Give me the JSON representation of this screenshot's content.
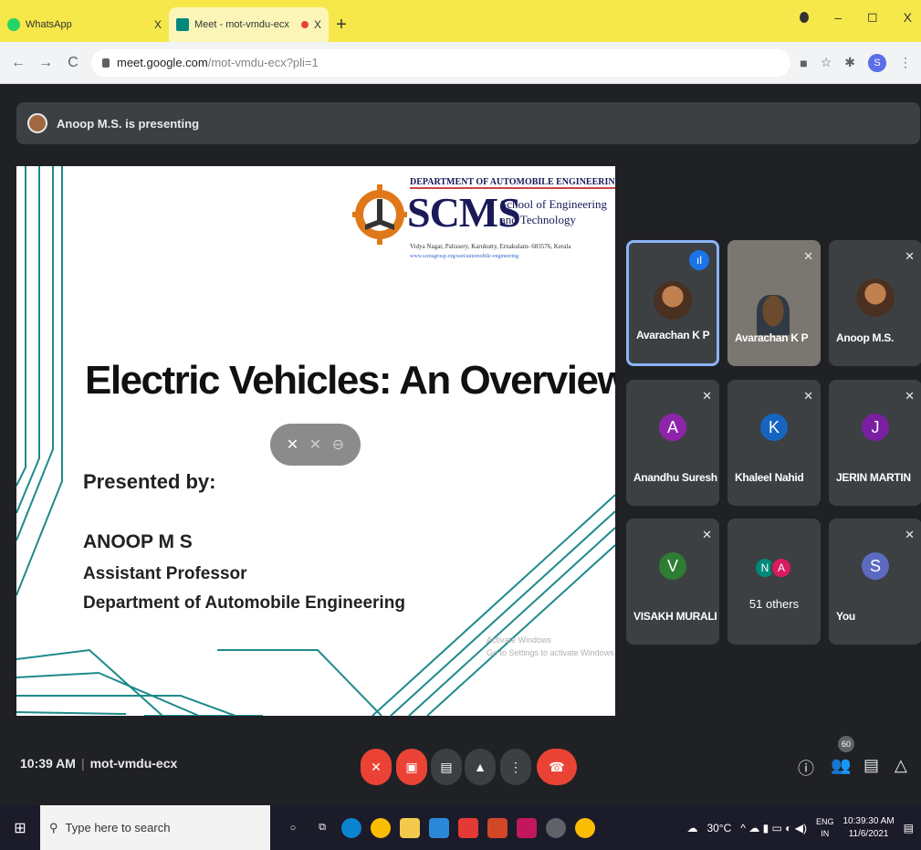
{
  "browser": {
    "tabs": [
      {
        "label": "WhatsApp",
        "close": "X"
      },
      {
        "label": "Meet - mot-vmdu-ecx",
        "close": "X"
      }
    ],
    "new_tab": "+",
    "window_controls": [
      "–",
      "◻",
      "X"
    ],
    "url_host": "meet.google.com",
    "url_path": "/mot-vmdu-ecx?pli=1",
    "profile_initial": "S"
  },
  "meet": {
    "presenting_text": "Anoop M.S. is presenting",
    "meeting_time": "10:39 AM",
    "meeting_code": "mot-vmdu-ecx",
    "participant_count": "60",
    "slide": {
      "dept_header": "DEPARTMENT OF AUTOMOBILE ENGINEERING",
      "logo_text": "SCMS",
      "school_line1": "School of Engineering",
      "school_line2": "and Technology",
      "address": "Vidya Nagar, Palissery, Karukutty, Ernakulam- 683576, Kerala",
      "website": "www.scmsgroup.org/sset/automobile-engineering",
      "title": "Electric Vehicles: An Overview",
      "presented_by": "Presented by:",
      "author": "ANOOP M S",
      "role": "Assistant Professor",
      "department": "Department of Automobile Engineering",
      "watermark_line1": "Activate Windows",
      "watermark_line2": "Go to Settings to activate Windows."
    },
    "tiles": [
      {
        "name": "Avarachan K P"
      },
      {
        "name": "Avarachan K P"
      },
      {
        "name": "Anoop M.S."
      },
      {
        "name": "Anandhu Suresh",
        "initial": "A",
        "color": "#8e24aa"
      },
      {
        "name": "Khaleel Nahid",
        "initial": "K",
        "color": "#1565c0"
      },
      {
        "name": "JERIN MARTIN",
        "initial": "J",
        "color": "#7b1fa2"
      },
      {
        "name": "VISAKH MURALI",
        "initial": "V",
        "color": "#2e7d32"
      },
      {
        "name": "51 others",
        "initials": [
          "N",
          "A"
        ],
        "colors": [
          "#00897b",
          "#d81b60"
        ]
      },
      {
        "name": "You",
        "initial": "S",
        "color": "#5c6bc0"
      }
    ]
  },
  "taskbar": {
    "search_placeholder": "Type here to search",
    "weather": "30°C",
    "lang_line1": "ENG",
    "lang_line2": "IN",
    "time": "10:39:30 AM",
    "date": "11/6/2021"
  }
}
